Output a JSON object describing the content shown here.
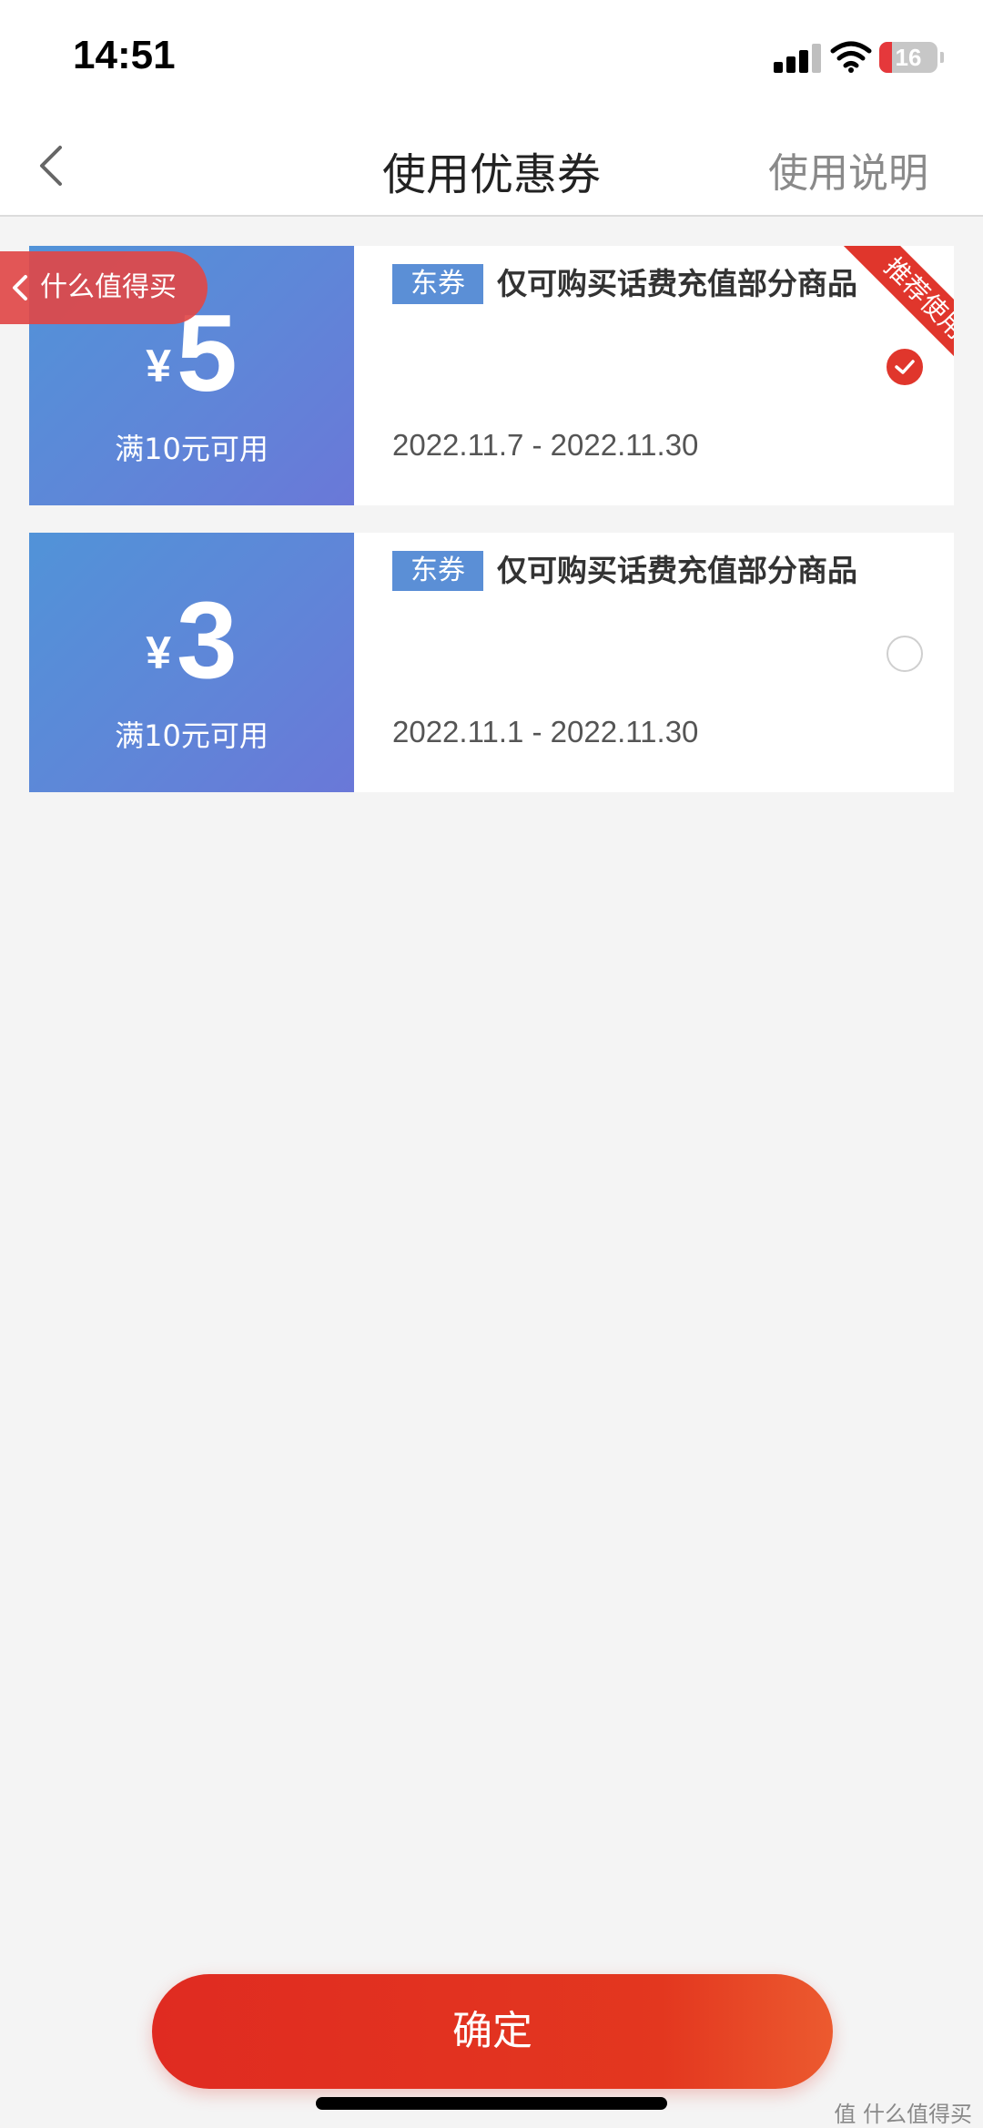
{
  "status_bar": {
    "time": "14:51",
    "battery": "16",
    "icons": [
      "signal-icon",
      "wifi-icon",
      "battery-icon"
    ]
  },
  "nav": {
    "back_icon": "chevron-left-icon",
    "title": "使用优惠券",
    "help": "使用说明"
  },
  "return_pill": {
    "icon": "chevron-left-icon",
    "label": "什么值得买"
  },
  "coupons": [
    {
      "currency": "¥",
      "amount": "5",
      "condition": "满10元可用",
      "tag": "东券",
      "description": "仅可购买话费充值部分商品",
      "date_range": "2022.11.7 - 2022.11.30",
      "ribbon": "推荐使用",
      "selected": true
    },
    {
      "currency": "¥",
      "amount": "3",
      "condition": "满10元可用",
      "tag": "东券",
      "description": "仅可购买话费充值部分商品",
      "date_range": "2022.11.1 - 2022.11.30",
      "selected": false
    }
  ],
  "footer": {
    "confirm": "确定",
    "watermark": "值 什么值得买"
  },
  "colors": {
    "accent": "#e0362c",
    "coupon_blue": "#5b8fd6",
    "background": "#f4f4f4"
  }
}
